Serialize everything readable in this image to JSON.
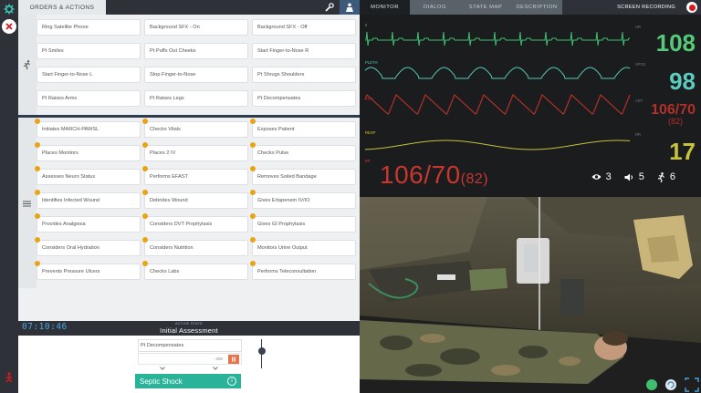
{
  "orders_panel": {
    "tab_label": "ORDERS & ACTIONS",
    "actions_row": [
      [
        "Ring Satellite Phone",
        "Background SFX - On",
        "Background SFX - Off"
      ],
      [
        "Pt Smiles",
        "Pt Puffs Out Cheeks",
        "Start Finger-to-Nose R"
      ],
      [
        "Start Finger-to-Nose L",
        "Stop Finger-to-Nose",
        "Pt Shrugs Shoulders"
      ],
      [
        "Pt Raises Arms",
        "Pt Raises Legs",
        "Pt Decompensates"
      ]
    ],
    "checklist": [
      [
        "Initiates MARCH-PAWSL",
        "Checks Vitals",
        "Exposes Patient"
      ],
      [
        "Places Monitors",
        "Places 2 IV",
        "Checks Pulse"
      ],
      [
        "Assesses Neuro Status",
        "Performs EFAST",
        "Removes Soiled Bandage"
      ],
      [
        "Identifies Infected Wound",
        "Debrides Wound",
        "Gives Ertapenem IV/IO"
      ],
      [
        "Provides Analgesia",
        "Considers DVT Prophylaxis",
        "Gives GI Prophylaxis"
      ],
      [
        "Considers Oral Hydration",
        "Considers Nutrition",
        "Monitors Urine Output"
      ],
      [
        "Prevents Pressure Ulcers",
        "Checks Labs",
        "Performs Teleconsultation"
      ]
    ],
    "accent_color": "#e8a317"
  },
  "scenario": {
    "clock": "07:10:46",
    "active_label": "ACTIVE STATE",
    "state_name": "Initial Assessment",
    "current_step": "Pt Decompensates",
    "timer_value": "000",
    "next_state": "Septic Shock",
    "next_state_color": "#2bb39a"
  },
  "monitor_tabs": {
    "tabs": [
      "MONITOR",
      "DIALOG",
      "STATE MAP",
      "DESCRIPTION"
    ],
    "recording_label": "SCREEN RECORDING"
  },
  "vitals": {
    "ecg_label": "II",
    "pleth_label": "PLETH",
    "art_label": "ART",
    "resp_label": "RESP",
    "nibp_label": "BP",
    "hr_label": "HR",
    "spo2_label": "SPO2",
    "abp_label": "ART",
    "rr_label": "RR",
    "hr": "108",
    "spo2": "98",
    "abp": "106/70",
    "abp_map": "(82)",
    "rr": "17",
    "nibp": "106/70",
    "nibp_map": "(82)",
    "colors": {
      "ecg": "#3fbf6f",
      "pleth": "#53c8b8",
      "art": "#b0302a",
      "resp": "#c8c23a",
      "hr": "#56c97a",
      "spo2": "#5ccbc0",
      "nibp": "#c9362f"
    }
  },
  "counters": {
    "eye": "3",
    "sound": "5",
    "walk": "6"
  }
}
